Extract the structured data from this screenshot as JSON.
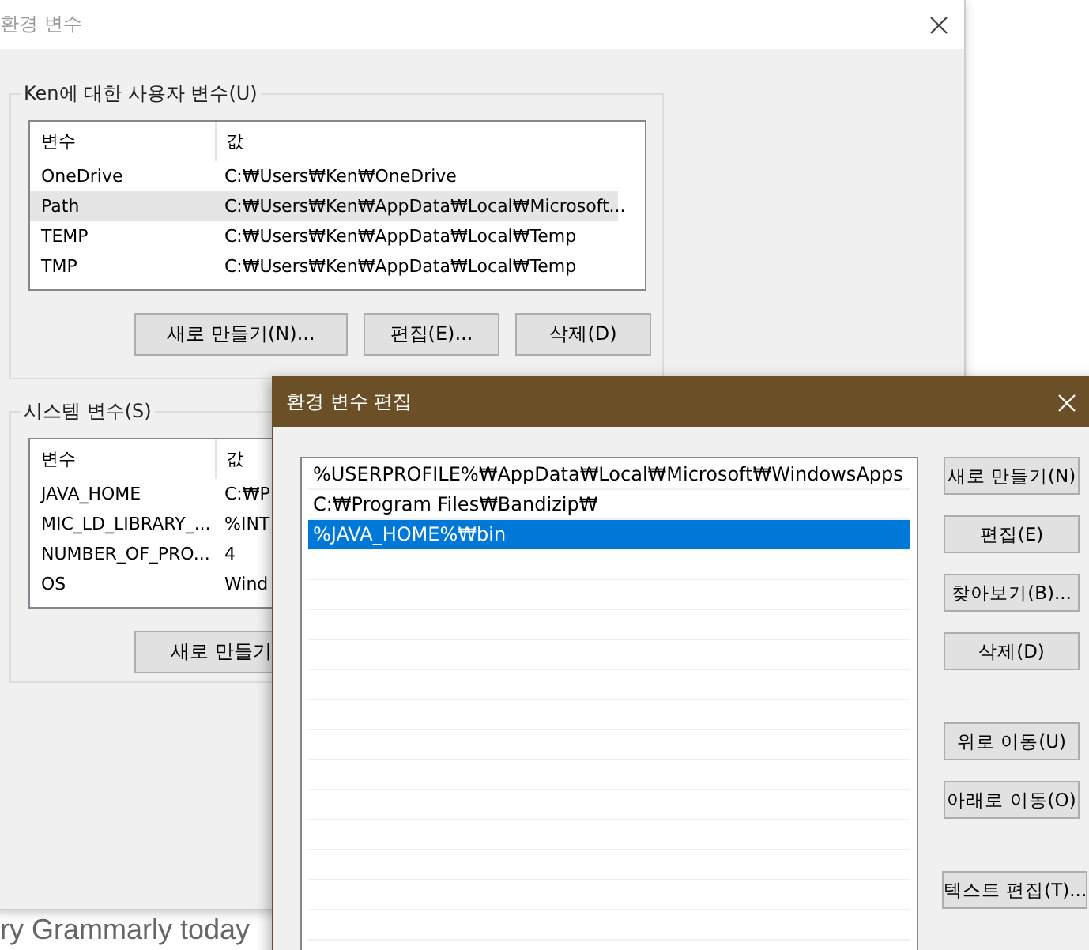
{
  "back_window": {
    "title": "환경 변수",
    "user_group": {
      "label": "Ken에 대한 사용자 변수(U)",
      "columns": [
        "변수",
        "값"
      ],
      "rows": [
        {
          "name": "OneDrive",
          "value": "C:₩Users₩Ken₩OneDrive",
          "selected": false
        },
        {
          "name": "Path",
          "value": "C:₩Users₩Ken₩AppData₩Local₩Microsoft...",
          "selected": true
        },
        {
          "name": "TEMP",
          "value": "C:₩Users₩Ken₩AppData₩Local₩Temp",
          "selected": false
        },
        {
          "name": "TMP",
          "value": "C:₩Users₩Ken₩AppData₩Local₩Temp",
          "selected": false
        }
      ],
      "buttons": [
        "새로 만들기(N)...",
        "편집(E)...",
        "삭제(D)"
      ]
    },
    "system_group": {
      "label": "시스템 변수(S)",
      "columns": [
        "변수",
        "값"
      ],
      "rows": [
        {
          "name": "JAVA_HOME",
          "value": "C:₩P"
        },
        {
          "name": "MIC_LD_LIBRARY_...",
          "value": "%INT"
        },
        {
          "name": "NUMBER_OF_PRO...",
          "value": "4"
        },
        {
          "name": "OS",
          "value": "Wind"
        }
      ],
      "buttons": [
        "새로 만들기"
      ]
    }
  },
  "background_text": "ry Grammarly today",
  "edit_dialog": {
    "title": "환경 변수 편집",
    "entries": [
      {
        "text": "%USERPROFILE%₩AppData₩Local₩Microsoft₩WindowsApps",
        "selected": false
      },
      {
        "text": "C:₩Program Files₩Bandizip₩",
        "selected": false
      },
      {
        "text": "%JAVA_HOME%₩bin",
        "selected": true
      }
    ],
    "button_groups": [
      [
        "새로 만들기(N)",
        "편집(E)",
        "찾아보기(B)...",
        "삭제(D)"
      ],
      [
        "위로 이동(U)",
        "아래로 이동(O)"
      ],
      [
        "텍스트 편집(T)..."
      ]
    ]
  }
}
